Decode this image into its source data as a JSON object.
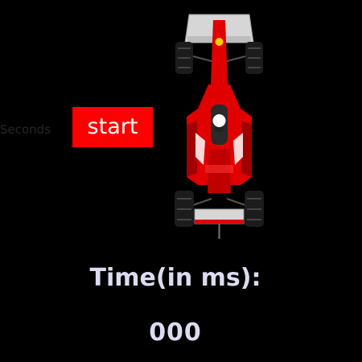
{
  "controls": {
    "left_label": "Seconds",
    "start_label": "start"
  },
  "timer": {
    "label": "Time(in ms):",
    "value": "000"
  },
  "car": {
    "icon": "race-car-icon",
    "colors": {
      "body": "#e00000",
      "body_dark": "#a00000",
      "wing": "#d9d9d9",
      "tire": "#1c1c1c",
      "helmet": "#ffffff",
      "nose_dot": "#ffcc00"
    }
  },
  "colors": {
    "background": "#000000",
    "button": "#ff0000",
    "text": "#dcdcf0"
  }
}
